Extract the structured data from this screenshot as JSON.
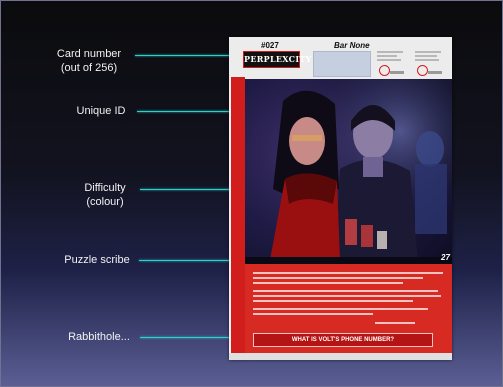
{
  "callouts": {
    "card_number": {
      "line1": "Card number",
      "line2": "(out of 256)"
    },
    "unique_id": "Unique ID",
    "difficulty": {
      "line1": "Difficulty",
      "line2": "(colour)"
    },
    "puzzle_scribe": "Puzzle scribe",
    "rabbithole": "Rabbithole..."
  },
  "card": {
    "number": "#027",
    "name": "Bar None",
    "logo": "PERPLEXCITY",
    "scribe": "27",
    "answer_prompt": "WHAT IS VOLT'S PHONE NUMBER?"
  },
  "colors": {
    "accent": "#2ad1cf",
    "difficulty_red": "#d21d1d",
    "card_panel": "#d72a22"
  }
}
